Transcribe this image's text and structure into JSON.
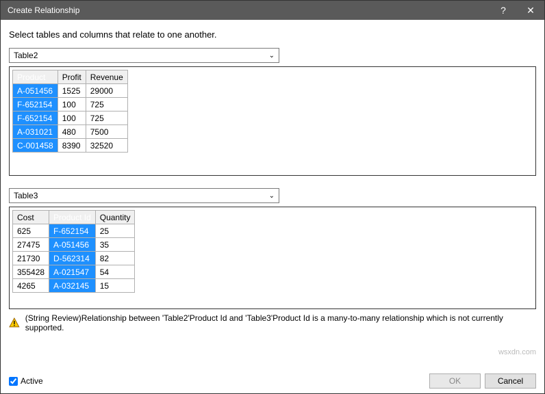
{
  "titlebar": {
    "title": "Create Relationship",
    "help": "?",
    "close": "✕"
  },
  "instruction": "Select tables and columns that relate to one another.",
  "top": {
    "combo": "Table2",
    "headers": [
      "Product",
      "Profit",
      "Revenue"
    ],
    "selected_col": 0,
    "rows": [
      [
        "A-051456",
        "1525",
        "29000"
      ],
      [
        "F-652154",
        "100",
        "725"
      ],
      [
        "F-652154",
        "100",
        "725"
      ],
      [
        "A-031021",
        "480",
        "7500"
      ],
      [
        "C-001458",
        "8390",
        "32520"
      ]
    ]
  },
  "bottom": {
    "combo": "Table3",
    "headers": [
      "Cost",
      "Product Id",
      "Quantity"
    ],
    "selected_col": 1,
    "rows": [
      [
        "625",
        "F-652154",
        "25"
      ],
      [
        "27475",
        "A-051456",
        "35"
      ],
      [
        "21730",
        "D-562314",
        "82"
      ],
      [
        "355428",
        "A-021547",
        "54"
      ],
      [
        "4265",
        "A-032145",
        "15"
      ]
    ]
  },
  "warning": "(String Review)Relationship between 'Table2'Product Id and 'Table3'Product Id is a many-to-many relationship which is not currently supported.",
  "footer": {
    "active": "Active",
    "ok": "OK",
    "cancel": "Cancel"
  },
  "watermark": "wsxdn.com"
}
